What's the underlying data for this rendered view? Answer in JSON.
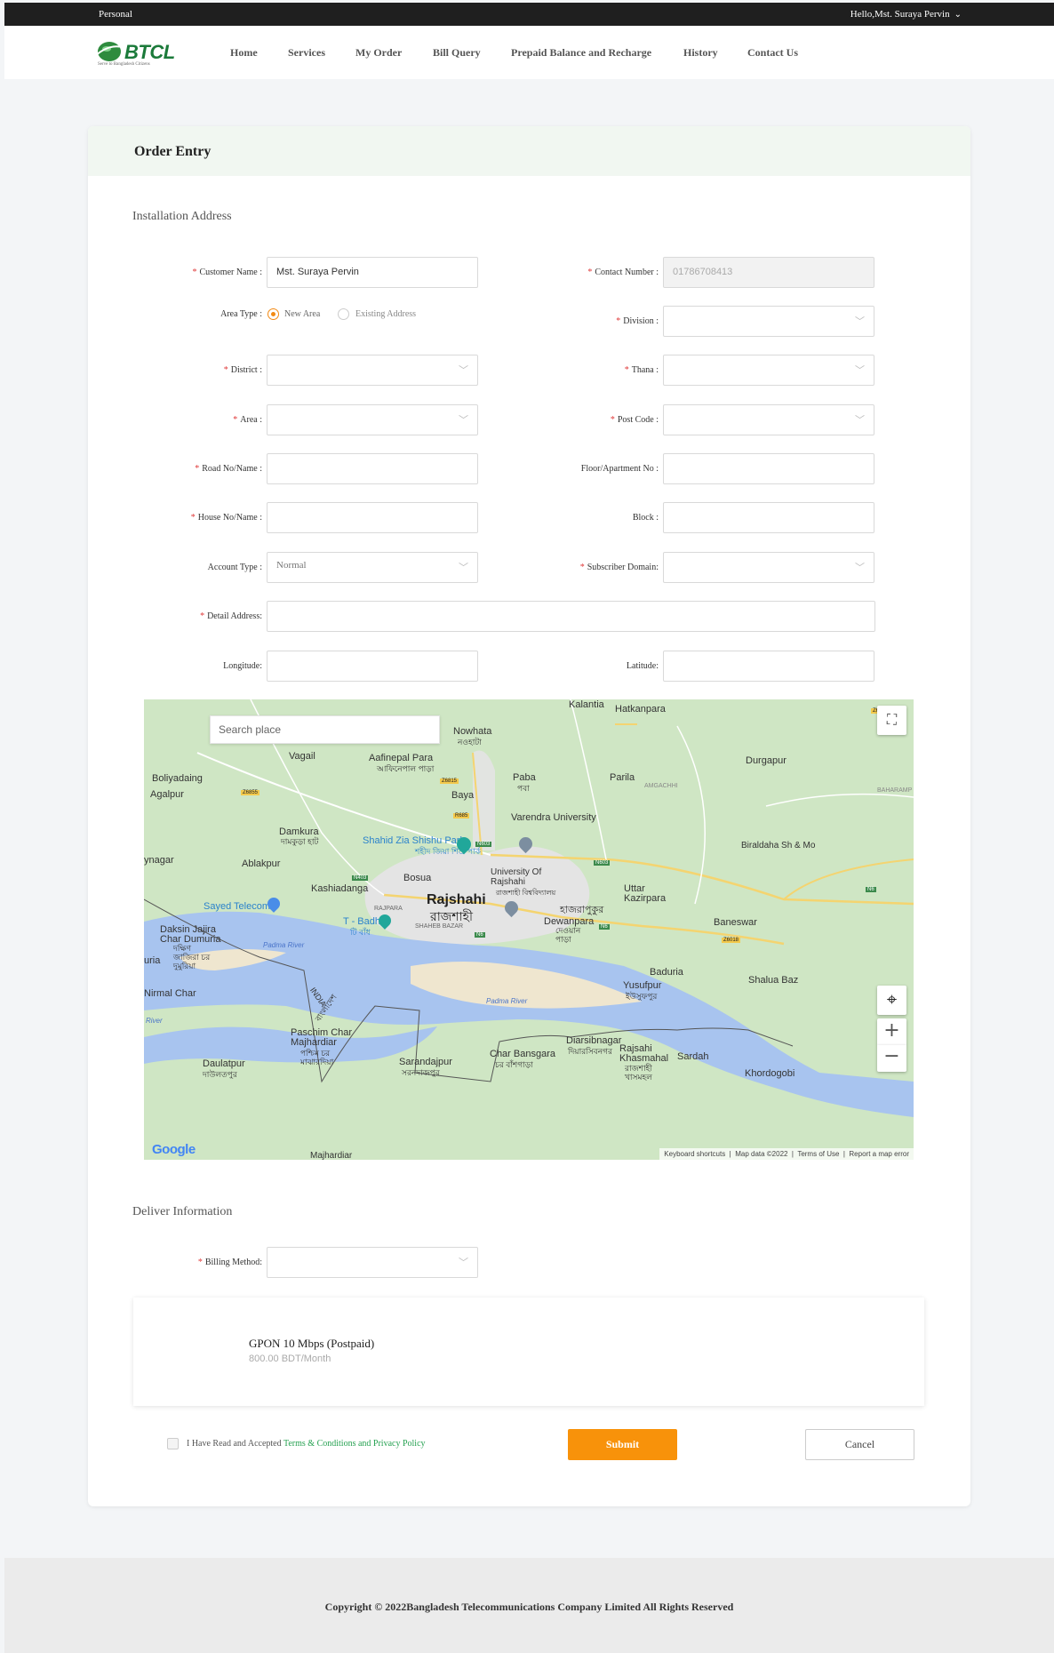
{
  "topbar": {
    "left": "Personal",
    "user": "Hello,Mst. Suraya Pervin"
  },
  "brand": {
    "name": "BTCL",
    "tagline": "Serve to Bangladesh Citizens"
  },
  "nav": {
    "home": "Home",
    "services": "Services",
    "my_order": "My Order",
    "bill_query": "Bill Query",
    "prepaid": "Prepaid Balance and Recharge",
    "history": "History",
    "contact": "Contact Us"
  },
  "page_title": "Order Entry",
  "installation": {
    "title": "Installation Address",
    "customer_name": {
      "label": "Customer Name",
      "value": "Mst. Suraya Pervin"
    },
    "contact_number": {
      "label": "Contact Number",
      "value": "01786708413"
    },
    "area_type": {
      "label": "Area Type",
      "options": [
        "New Area",
        "Existing Address"
      ],
      "selected": "New Area"
    },
    "division": {
      "label": "Division",
      "value": ""
    },
    "district": {
      "label": "District",
      "value": ""
    },
    "thana": {
      "label": "Thana",
      "value": ""
    },
    "area": {
      "label": "Area",
      "value": ""
    },
    "post_code": {
      "label": "Post Code",
      "value": ""
    },
    "road": {
      "label": "Road No/Name",
      "value": ""
    },
    "floor": {
      "label": "Floor/Apartment No",
      "value": ""
    },
    "house": {
      "label": "House No/Name",
      "value": ""
    },
    "block": {
      "label": "Block",
      "value": ""
    },
    "account_type": {
      "label": "Account Type",
      "value": "Normal"
    },
    "subscriber_domain": {
      "label": "Subscriber Domain",
      "value": ""
    },
    "detail_address": {
      "label": "Detail Address",
      "value": ""
    },
    "longitude": {
      "label": "Longitude",
      "value": ""
    },
    "latitude": {
      "label": "Latitude",
      "value": ""
    }
  },
  "map": {
    "search_placeholder": "Search place",
    "labels": {
      "kalantia": "Kalantia",
      "hatkanpara": "Hatkanpara",
      "nowhata": "Nowhata",
      "nowhata_bn": "নওহাটা",
      "vagail": "Vagail",
      "aafinepal": "Aafinepal Para",
      "aafinepal_bn": "আফিনেপাল পাড়া",
      "durgapur": "Durgapur",
      "boliyadaing": "Boliyadaing",
      "agalpur": "Agalpur",
      "paba": "Paba",
      "paba_bn": "পবা",
      "parila": "Parila",
      "amgachhi": "AMGACHHI",
      "baharampur": "BAHARAMP",
      "baya": "Baya",
      "varendra": "Varendra University",
      "damkura": "Damkura",
      "damkura_bn": "দামকুড়া হাট",
      "shahid_park": "Shahid Zia Shishu Park",
      "shahid_park_bn": "শহীদ জিয়া শিশু পার্ক",
      "biraldaha": "Biraldaha Sh & Mo",
      "ynagar": "ynagar",
      "ablakpur": "Ablakpur",
      "university": "University Of Rajshahi",
      "university_bn": "রাজশাহী বিশ্ববিদ্যালয়",
      "bosua": "Bosua",
      "kashiadanga": "Kashiadanga",
      "uttar": "Uttar Kazirpara",
      "sayed_telecom": "Sayed Telecom",
      "rajshahi": "Rajshahi",
      "rajshahi_bn": "রাজশাহী",
      "rajpara": "RAJPARA",
      "hajrapukur_bn": "হাজরাপুকুর",
      "t_badh": "T - Badh",
      "t_badh_bn": "টি বাঁধ",
      "shaheb_bazar": "SHAHEB BAZAR",
      "dewanpara": "Dewanpara",
      "dewanpara_bn": "দেওয়ান পাড়া",
      "baneswar": "Baneswar",
      "daksin_jajira": "Daksin Jajira",
      "char_dumuria": "Char Dumuria",
      "jajira_bn": "দক্ষিণ জাজিরা চর দুমুরিয়া",
      "uria": "uria",
      "padma1": "Padma River",
      "padma2": "Padma River",
      "baduria": "Baduria",
      "shalua": "Shalua Baz",
      "yusufpur": "Yusufpur",
      "yusufpur_bn": "ইউসুফপুর",
      "nirmal_char": "Nirmal Char",
      "india": "INDIA",
      "bangladesh_bn": "বাংলাদেশ",
      "river3": "River",
      "paschim": "Paschim Char Majhardiar",
      "paschim_bn": "পশ্চিম চর মাঝারদিয়া",
      "diarsibnagar": "Diarsibnagar",
      "diarsibnagar_bn": "দিয়ারসিবনগর",
      "rajsahi_khasmahal": "Rajsahi Khasmahal",
      "khasmahal_bn": "রাজশাহী খাসমহল",
      "sardah": "Sardah",
      "char_bansgara": "Char Bansgara",
      "bansgara_bn": "চর বাঁশগাড়া",
      "daulatpur": "Daulatpur",
      "daulatpur_bn": "দাউলতপুর",
      "sarandajpur": "Sarandajpur",
      "sarandajpur_bn": "সরনদাজপুর",
      "khordogobi": "Khordogobi",
      "majhardiar": "Majhardiar"
    },
    "road_badges": {
      "z6815": "Z6815",
      "z6855": "Z6855",
      "r685": "R685",
      "n603a": "N603",
      "n603b": "N603",
      "n403": "N403",
      "n6a": "N6",
      "n6b": "N6",
      "n6c": "N6",
      "z6018": "Z6018",
      "z6": "Z6"
    },
    "footer": {
      "shortcuts": "Keyboard shortcuts",
      "data": "Map data ©2022",
      "terms": "Terms of Use",
      "report": "Report a map error"
    },
    "google": "Google"
  },
  "deliver": {
    "title": "Deliver Information",
    "billing": {
      "label": "Billing Method",
      "value": ""
    }
  },
  "package": {
    "name": "GPON 10 Mbps (Postpaid)",
    "price": "800.00 BDT/Month"
  },
  "agreement": {
    "prefix": "I Have Read and Accepted",
    "link": "Terms & Conditions and Privacy Policy"
  },
  "buttons": {
    "submit": "Submit",
    "cancel": "Cancel"
  },
  "footer": {
    "copyright": "Copyright © 2022Bangladesh Telecommunications Company Limited All Rights Reserved"
  },
  "colors": {
    "accent": "#f8920a",
    "brand_green": "#26a151",
    "required": "#e03c3c",
    "river": "#a8c4ef"
  }
}
